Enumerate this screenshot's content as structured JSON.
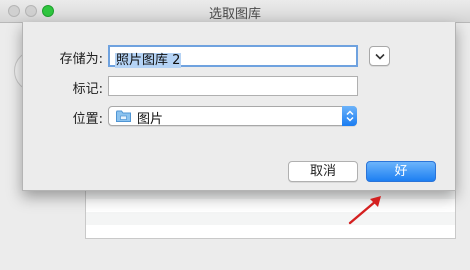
{
  "window": {
    "title": "选取图库"
  },
  "dialog": {
    "save_as_label": "存储为:",
    "save_as_value": "照片图库 2",
    "tags_label": "标记:",
    "tags_value": "",
    "location_label": "位置:",
    "location_value": "图片",
    "cancel_label": "取消",
    "ok_label": "好"
  },
  "colors": {
    "accent": "#1d7ff2",
    "annotation_arrow": "#d42020"
  },
  "icons": {
    "expand": "chevron-down-icon",
    "folder": "folder-icon",
    "popup": "updown-arrows-icon"
  }
}
